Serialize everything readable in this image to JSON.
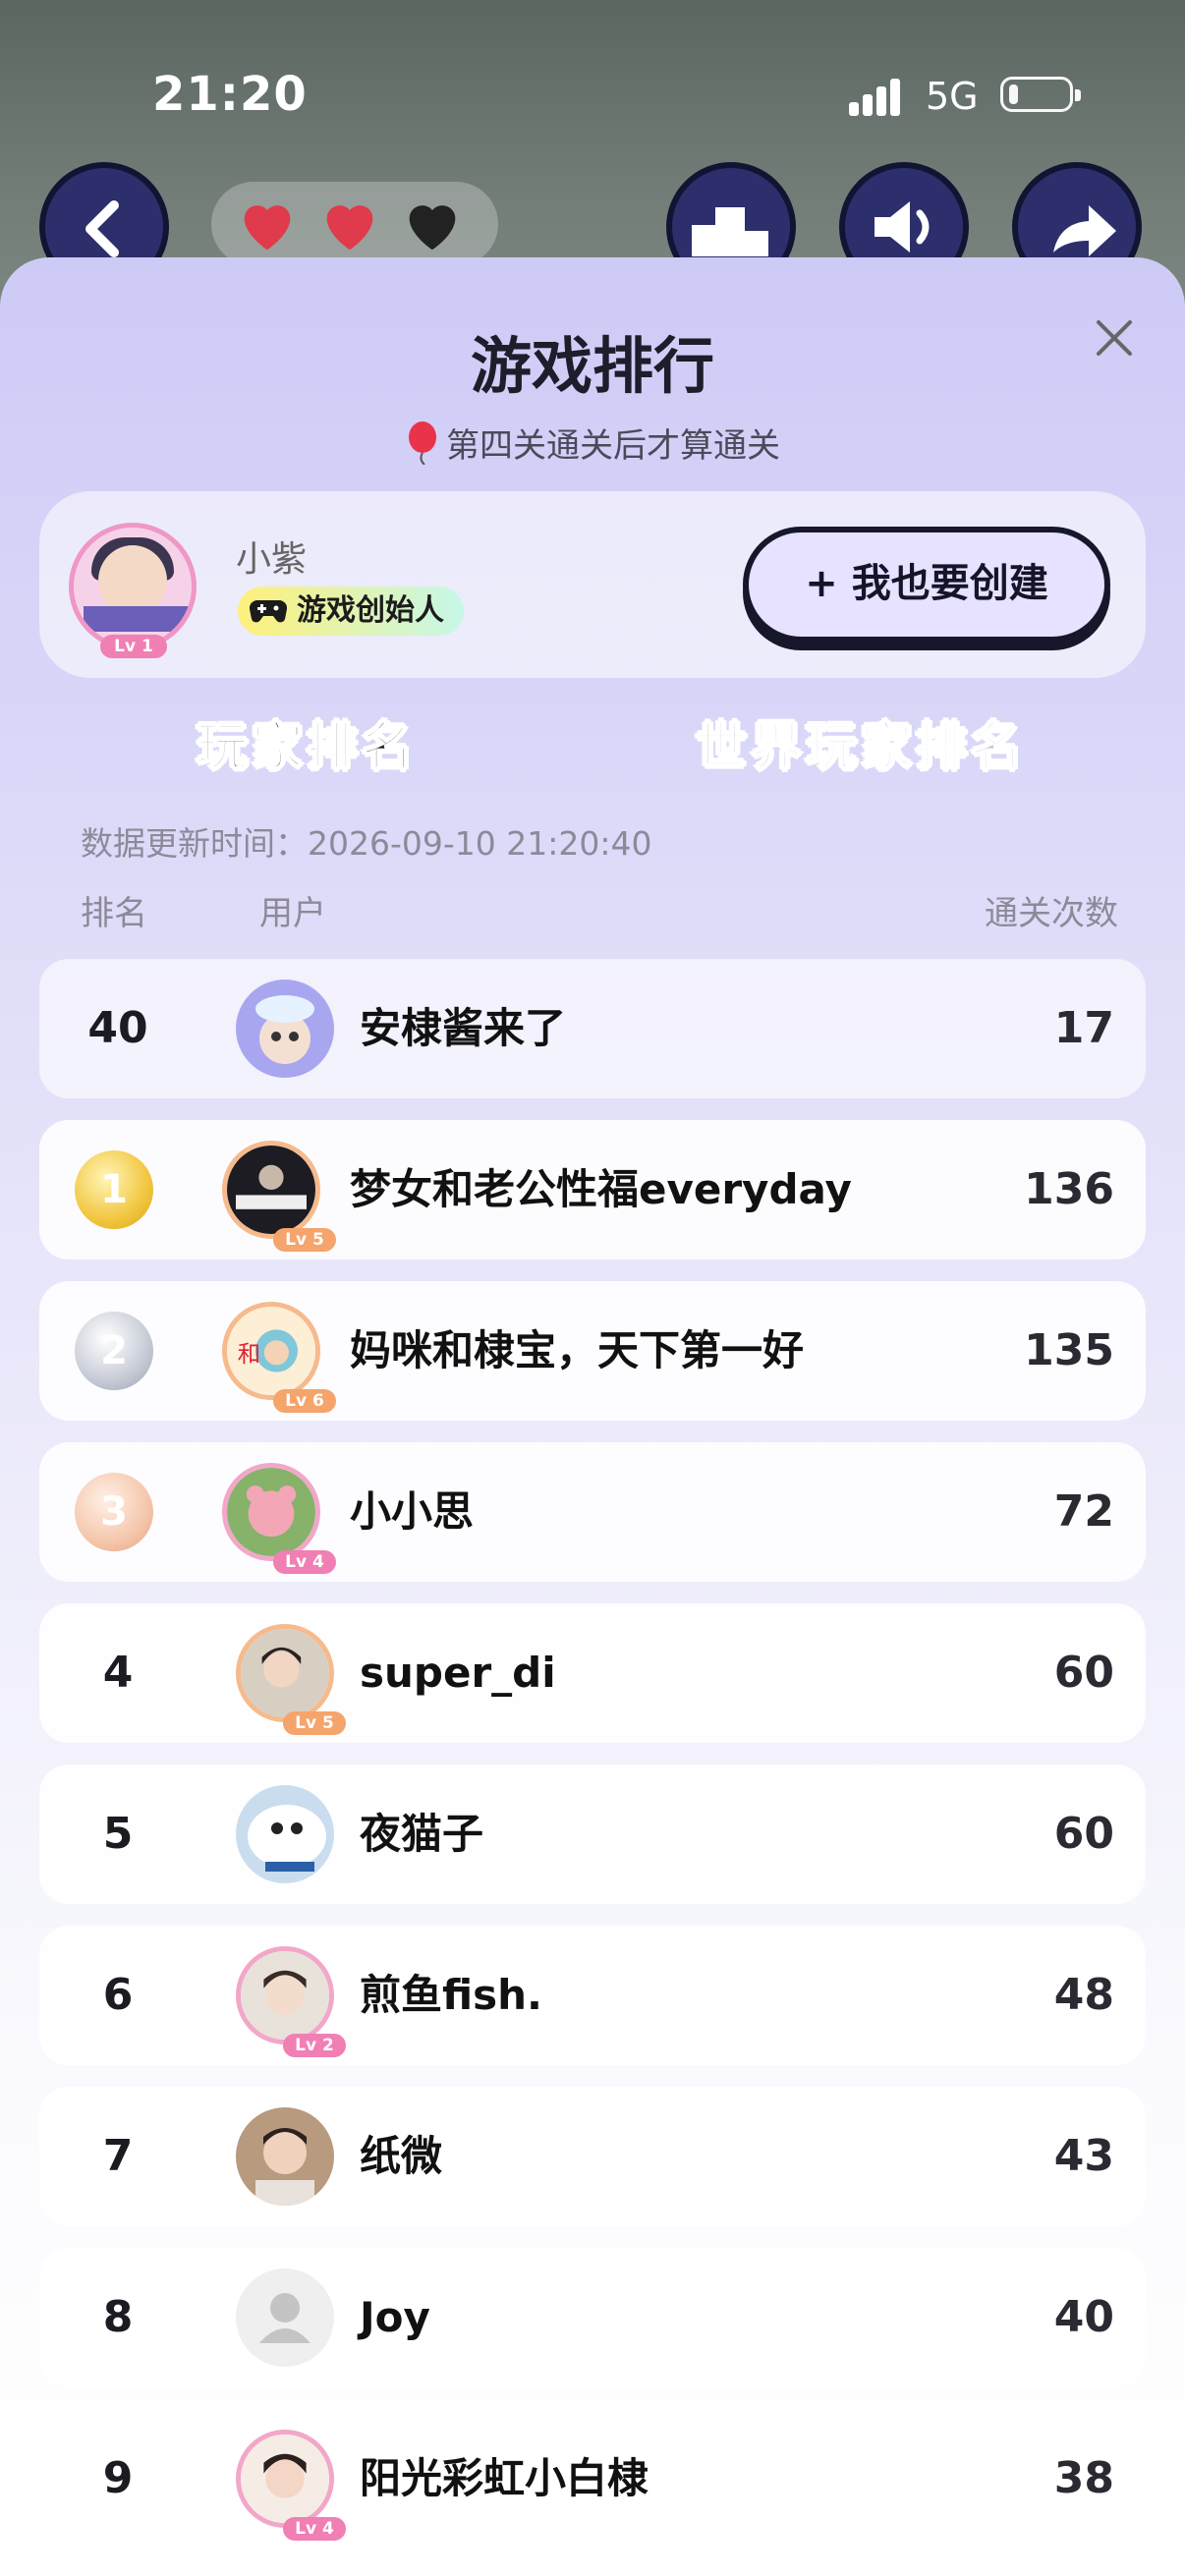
{
  "status": {
    "time": "21:20",
    "network": "5G",
    "battery_percent": 15
  },
  "top_buttons": [
    "back-icon",
    "leaderboard-icon",
    "sound-icon",
    "share-icon"
  ],
  "lives": {
    "total": 3,
    "filled": 2,
    "filled_color": "#e03a4d",
    "empty_color": "#222222"
  },
  "header": {
    "title": "游戏排行",
    "subtitle": "第四关通关后才算通关",
    "close_icon": "close-icon"
  },
  "creator": {
    "name": "小紫",
    "level": "Lv 1",
    "tag": "游戏创始人",
    "create_button": "+ 我也要创建"
  },
  "tabs": {
    "player": "玩家排名",
    "world": "世界玩家排名",
    "active": "player"
  },
  "updated": "数据更新时间：2026-09-10 21:20:40",
  "columns": {
    "rank": "排名",
    "user": "用户",
    "count": "通关次数"
  },
  "self_row": {
    "rank": "40",
    "name": "安棣酱来了",
    "count": "17"
  },
  "rows": [
    {
      "rank": "1",
      "name": "梦女和老公性福everyday",
      "count": "136",
      "level": "Lv 5",
      "medal": "gold"
    },
    {
      "rank": "2",
      "name": "妈咪和棣宝，天下第一好",
      "count": "135",
      "level": "Lv 6",
      "medal": "silver"
    },
    {
      "rank": "3",
      "name": "小小思",
      "count": "72",
      "level": "Lv 4",
      "medal": "bronze"
    },
    {
      "rank": "4",
      "name": "super_di",
      "count": "60",
      "level": "Lv 5"
    },
    {
      "rank": "5",
      "name": "夜猫子",
      "count": "60"
    },
    {
      "rank": "6",
      "name": "煎鱼fish.",
      "count": "48",
      "level": "Lv 2"
    },
    {
      "rank": "7",
      "name": "纸微",
      "count": "43"
    },
    {
      "rank": "8",
      "name": "Joy",
      "count": "40"
    },
    {
      "rank": "9",
      "name": "阳光彩虹小白棣",
      "count": "38",
      "level": "Lv 4"
    }
  ]
}
